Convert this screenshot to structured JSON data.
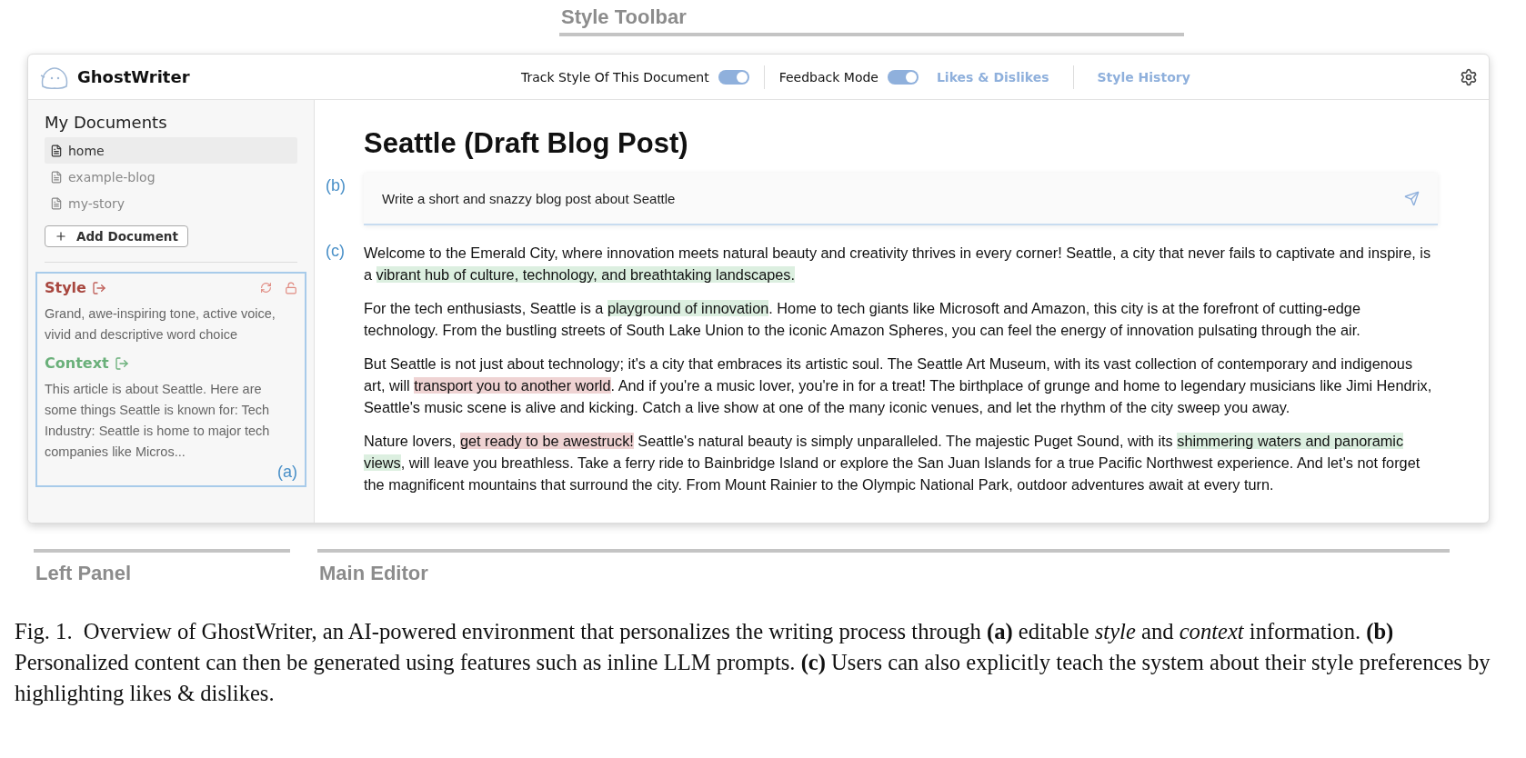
{
  "figure_labels": {
    "toolbar": "Style Toolbar",
    "left_panel": "Left Panel",
    "main_editor": "Main Editor"
  },
  "app": {
    "name": "GhostWriter"
  },
  "toolbar": {
    "toggles": [
      {
        "label": "Track Style Of This Document",
        "on": true
      },
      {
        "label": "Feedback Mode",
        "on": true
      }
    ],
    "links": [
      "Likes & Dislikes",
      "Style History"
    ]
  },
  "sidebar": {
    "heading": "My Documents",
    "documents": [
      {
        "name": "home",
        "selected": true
      },
      {
        "name": "example-blog",
        "selected": false
      },
      {
        "name": "my-story",
        "selected": false
      }
    ],
    "add_button": "Add Document"
  },
  "profile": {
    "style_title": "Style",
    "style_text": "Grand, awe-inspiring tone, active voice, vivid and descriptive word choice",
    "context_title": "Context",
    "context_text": "This article is about Seattle. Here are some things Seattle is known for: Tech Industry: Seattle is home to major tech companies like Micros...",
    "marker": "(a)"
  },
  "editor": {
    "title": "Seattle (Draft Blog Post)",
    "prompt_marker": "(b)",
    "prompt": "Write a short and snazzy blog post about Seattle",
    "text_marker": "(c)",
    "paragraphs": [
      [
        {
          "kind": "plain",
          "text": "Welcome to the Emerald City, where innovation meets natural beauty and creativity thrives in every corner! Seattle, a city that never fails to captivate and inspire, is a "
        },
        {
          "kind": "like",
          "text": "vibrant hub of culture, technology, and breathtaking landscapes."
        }
      ],
      [
        {
          "kind": "plain",
          "text": "For the tech enthusiasts, Seattle is a "
        },
        {
          "kind": "like",
          "text": "playground of innovation"
        },
        {
          "kind": "plain",
          "text": ". Home to tech giants like Microsoft and Amazon, this city is at the forefront of cutting-edge technology. From the bustling streets of South Lake Union to the iconic Amazon Spheres, you can feel the energy of innovation pulsating through the air."
        }
      ],
      [
        {
          "kind": "plain",
          "text": "But Seattle is not just about technology; it's a city that embraces its artistic soul. The Seattle Art Museum, with its vast collection of contemporary and indigenous art, will "
        },
        {
          "kind": "dislike",
          "text": "transport you to another world"
        },
        {
          "kind": "plain",
          "text": ". And if you're a music lover, you're in for a treat! The birthplace of grunge and home to legendary musicians like Jimi Hendrix, Seattle's music scene is alive and kicking. Catch a live show at one of the many iconic venues, and let the rhythm of the city sweep you away."
        }
      ],
      [
        {
          "kind": "plain",
          "text": "Nature lovers, "
        },
        {
          "kind": "dislike",
          "text": "get ready to be awestruck!"
        },
        {
          "kind": "plain",
          "text": " Seattle's natural beauty is simply unparalleled. The majestic Puget Sound, with its "
        },
        {
          "kind": "like",
          "text": "shimmering waters and panoramic views"
        },
        {
          "kind": "plain",
          "text": ", will leave you breathless. Take a ferry ride to Bainbridge Island or explore the San Juan Islands for a true Pacific Northwest experience. And let's not forget the magnificent mountains that surround the city. From Mount Rainier to the Olympic National Park, outdoor adventures await at every turn."
        }
      ]
    ]
  },
  "caption": "Fig. 1.  Overview of GhostWriter, an AI-powered environment that personalizes the writing process through **(a)** editable *style* and *context* information. **(b)** Personalized content can then be generated using features such as inline LLM prompts. **(c)** Users can also explicitly teach the system about their style preferences by highlighting likes & dislikes."
}
